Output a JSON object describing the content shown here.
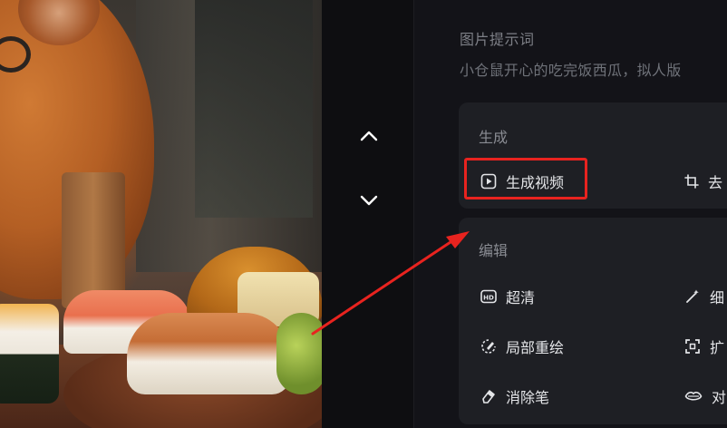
{
  "prompt": {
    "title": "图片提示词",
    "text": "小仓鼠开心的吃完饭西瓜，拟人版"
  },
  "navigation": {
    "up_icon": "chevron-up-icon",
    "down_icon": "chevron-down-icon"
  },
  "generate_section": {
    "title": "生成",
    "actions": [
      {
        "label": "生成视频",
        "icon": "play-video-icon"
      },
      {
        "label": "去",
        "icon": "crop-icon"
      }
    ]
  },
  "edit_section": {
    "title": "编辑",
    "actions": [
      {
        "label": "超清",
        "icon": "hd-icon"
      },
      {
        "label": "细",
        "icon": "magic-wand-icon"
      },
      {
        "label": "局部重绘",
        "icon": "partial-redraw-icon"
      },
      {
        "label": "扩",
        "icon": "expand-icon"
      },
      {
        "label": "消除笔",
        "icon": "eraser-icon"
      },
      {
        "label": "对",
        "icon": "lips-icon"
      }
    ]
  },
  "annotation": {
    "highlight_color": "#e8231f",
    "arrow_color": "#e8231f"
  }
}
